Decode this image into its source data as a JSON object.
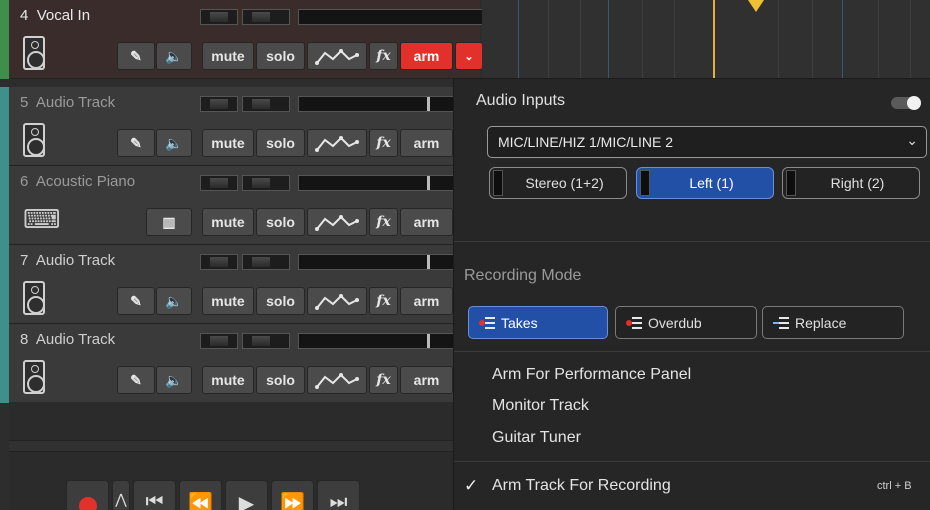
{
  "tracks": [
    {
      "number": "4",
      "name": "Vocal In",
      "color": "#3f8f4a",
      "selected": true,
      "armed": true,
      "instrument": false
    },
    {
      "number": "5",
      "name": "Audio Track",
      "color": "#3f8f8a",
      "selected": false,
      "armed": false,
      "instrument": false
    },
    {
      "number": "6",
      "name": "Acoustic Piano",
      "color": "#3f8f8a",
      "selected": false,
      "armed": false,
      "instrument": true
    },
    {
      "number": "7",
      "name": "Audio Track",
      "color": "#3f8f8a",
      "selected": false,
      "armed": false,
      "instrument": false
    },
    {
      "number": "8",
      "name": "Audio Track",
      "color": "#3f8f8a",
      "selected": false,
      "armed": false,
      "instrument": false
    }
  ],
  "track_buttons": {
    "mute": "mute",
    "solo": "solo",
    "fx": "fx",
    "arm": "arm",
    "dropdown": "⌄"
  },
  "popup": {
    "audio_inputs_label": "Audio Inputs",
    "input_select_value": "MIC/LINE/HIZ 1/MIC/LINE 2",
    "channels": [
      {
        "label": "Stereo (1+2)",
        "selected": false
      },
      {
        "label": "Left (1)",
        "selected": true
      },
      {
        "label": "Right (2)",
        "selected": false
      }
    ],
    "recording_mode_label": "Recording Mode",
    "modes": [
      {
        "label": "Takes",
        "selected": true
      },
      {
        "label": "Overdub",
        "selected": false
      },
      {
        "label": "Replace",
        "selected": false
      }
    ],
    "menu_items": [
      "Arm For Performance Panel",
      "Monitor Track",
      "Guitar Tuner"
    ],
    "arm_item": {
      "check": "✓",
      "label": "Arm Track For Recording",
      "shortcut": "ctrl + B"
    }
  },
  "colors": {
    "record_red": "#e2302a",
    "selection_blue": "#2250a6"
  }
}
